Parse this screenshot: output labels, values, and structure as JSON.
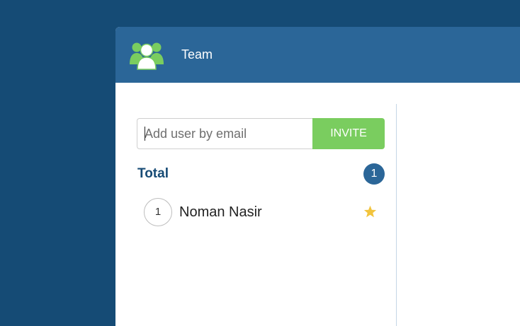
{
  "header": {
    "title": "Team",
    "icon": "team-users-icon",
    "background": "#2b6698"
  },
  "invite": {
    "placeholder": "Add user by email",
    "value": "",
    "button_label": "INVITE",
    "button_color": "#7acd5f"
  },
  "summary": {
    "label": "Total",
    "count": "1"
  },
  "members": [
    {
      "index": "1",
      "name": "Noman Nasir",
      "starred": true,
      "star_icon": "star-icon"
    }
  ],
  "colors": {
    "page_background": "#154b75",
    "accent": "#2b6698",
    "star": "#f2c43d",
    "team_icon_green": "#7acd5f"
  }
}
